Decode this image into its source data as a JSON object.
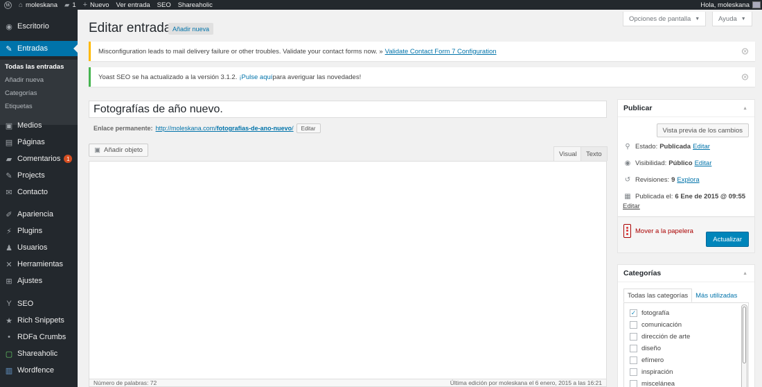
{
  "adminbar": {
    "site_name": "moleskana",
    "comments_count": "1",
    "new_label": "Nuevo",
    "view_post": "Ver entrada",
    "seo": "SEO",
    "shareaholic": "Shareaholic",
    "greeting": "Hola, moleskana"
  },
  "sidebar": {
    "escritorio": "Escritorio",
    "entradas": "Entradas",
    "sub": {
      "all": "Todas las entradas",
      "add": "Añadir nueva",
      "categories": "Categorías",
      "tags": "Etiquetas"
    },
    "medios": "Medios",
    "paginas": "Páginas",
    "comentarios": "Comentarios",
    "comentarios_badge": "1",
    "projects": "Projects",
    "contacto": "Contacto",
    "apariencia": "Apariencia",
    "plugins": "Plugins",
    "usuarios": "Usuarios",
    "herramientas": "Herramientas",
    "ajustes": "Ajustes",
    "seo": "SEO",
    "rich_snippets": "Rich Snippets",
    "rdfa": "RDFa Crumbs",
    "shareaholic": "Shareaholic",
    "wordfence": "Wordfence"
  },
  "header": {
    "title": "Editar entrada",
    "add_new": "Añadir nueva",
    "screen_options": "Opciones de pantalla",
    "help": "Ayuda"
  },
  "notices": {
    "cf7_text": "Misconfiguration leads to mail delivery failure or other troubles. Validate your contact forms now. »",
    "cf7_link": "Validate Contact Form 7 Configuration",
    "yoast_before": "Yoast SEO se ha actualizado a la versión 3.1.2. ",
    "yoast_link": "¡Pulse aquí",
    "yoast_after": " para averiguar las novedades!"
  },
  "post": {
    "title": "Fotografías de año nuevo.",
    "permalink_label": "Enlace permanente:",
    "permalink_base": "http://moleskana.com/",
    "permalink_slug": "fotografias-de-ano-nuevo",
    "permalink_end": "/",
    "edit": "Editar"
  },
  "editor": {
    "add_media": "Añadir objeto",
    "tab_visual": "Visual",
    "tab_text": "Texto",
    "word_count": "Número de palabras: 72",
    "last_edit": "Última edición por moleskana el 6 enero, 2015 a las 16:21"
  },
  "publish": {
    "title": "Publicar",
    "preview": "Vista previa de los cambios",
    "status_label": "Estado:",
    "status_value": "Publicada",
    "visibility_label": "Visibilidad:",
    "visibility_value": "Público",
    "revisions_label": "Revisiones:",
    "revisions_value": "9",
    "revisions_link": "Explora",
    "published_label": "Publicada el:",
    "published_value": "6 Ene de 2015 @ 09:55",
    "edit": "Editar",
    "trash": "Mover a la papelera",
    "update": "Actualizar"
  },
  "categories": {
    "title": "Categorías",
    "tab_all": "Todas las categorías",
    "tab_popular": "Más utilizadas",
    "items": [
      {
        "label": "fotografía",
        "checked": true
      },
      {
        "label": "comunicación",
        "checked": false
      },
      {
        "label": "dirección de arte",
        "checked": false
      },
      {
        "label": "diseño",
        "checked": false
      },
      {
        "label": "efímero",
        "checked": false
      },
      {
        "label": "inspiración",
        "checked": false
      },
      {
        "label": "miscelánea",
        "checked": false
      }
    ]
  },
  "colors": {
    "adminbar_bg": "#23282d",
    "accent": "#0073aa",
    "primary_button": "#0085ba",
    "warning_border": "#ffb900",
    "success_border": "#46b450",
    "badge": "#d54e21",
    "trash": "#a00"
  }
}
